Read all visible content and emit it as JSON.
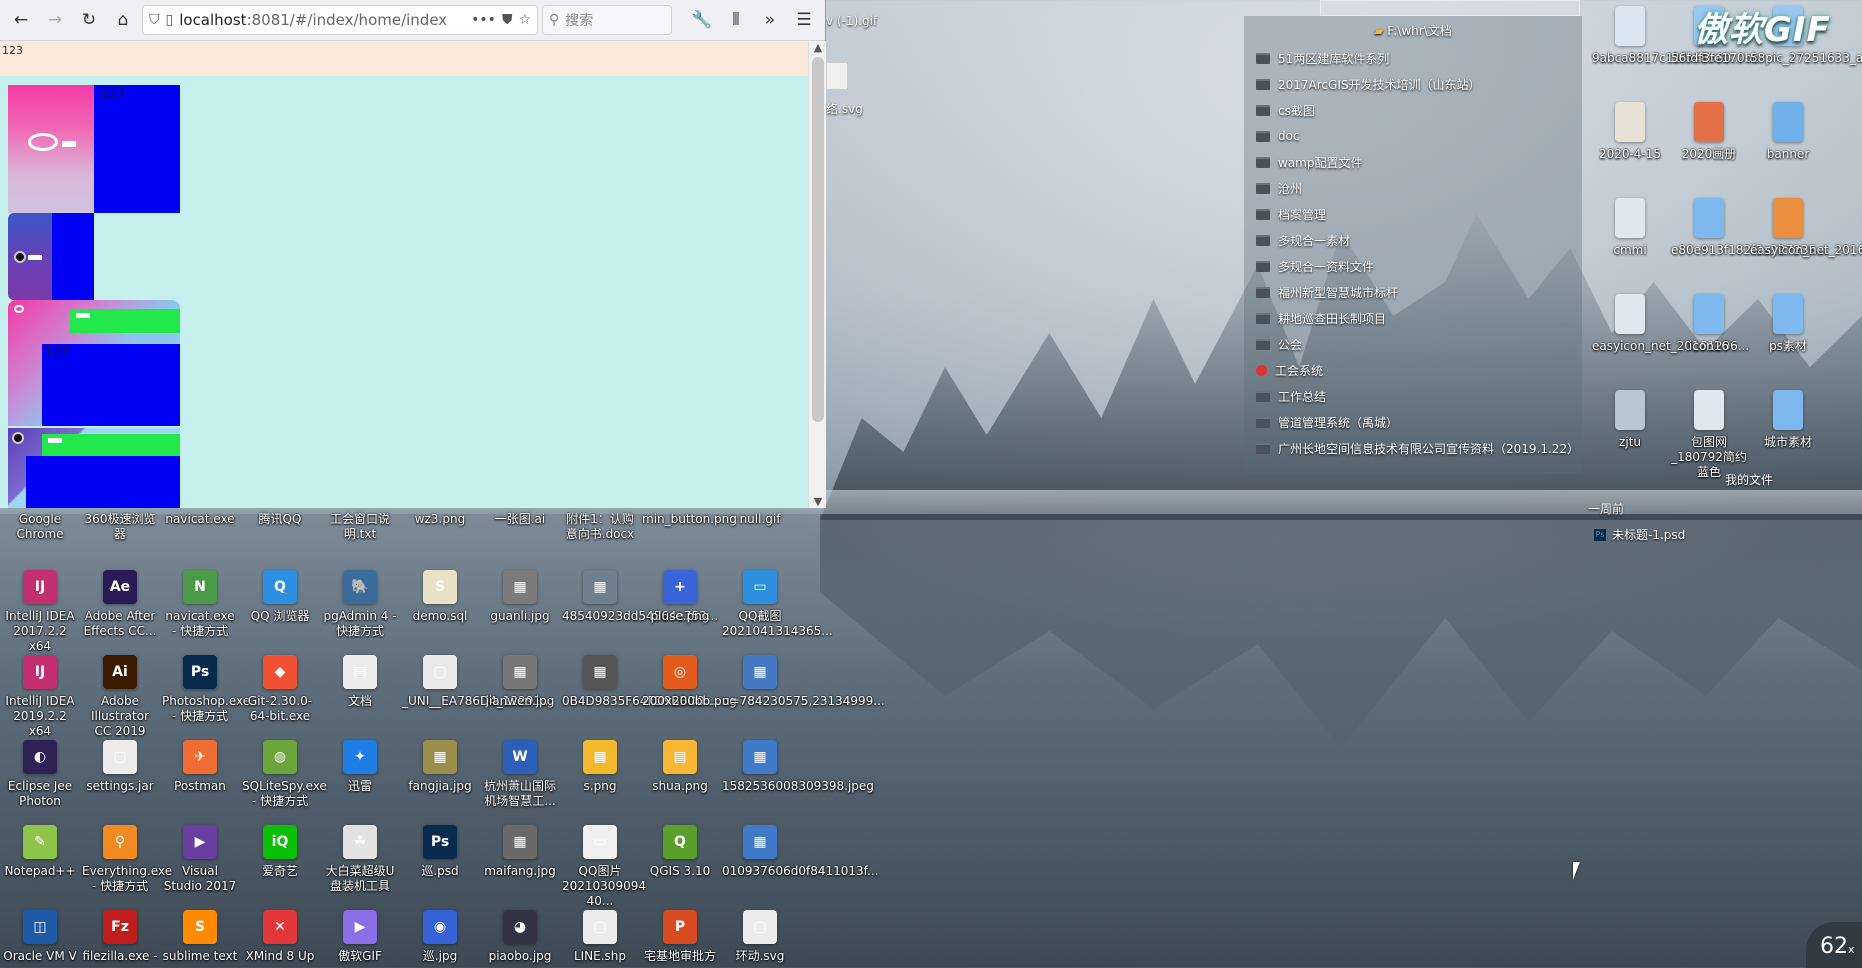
{
  "browser": {
    "url_host": "localhost",
    "url_rest": ":8081/#/index/home/index",
    "search_placeholder": "搜索",
    "page_header_text": "123",
    "blocks": [
      {
        "label": "123"
      },
      {
        "label": "123"
      }
    ]
  },
  "desktop_icons": [
    {
      "label": "Google Chrome",
      "glyph": "●",
      "color": "#e2473a"
    },
    {
      "label": "360极速浏览器",
      "glyph": "◉",
      "color": "#3a8fe2"
    },
    {
      "label": "navicat.exe",
      "glyph": "N",
      "color": "#4a9a4a"
    },
    {
      "label": "腾讯QQ",
      "glyph": "Q",
      "color": "#2b7fd5"
    },
    {
      "label": "工会窗口说明.txt",
      "glyph": "≡",
      "color": "#dcdcdc"
    },
    {
      "label": "wz3.png",
      "glyph": "▣",
      "color": "#3c7fbf"
    },
    {
      "label": "一张图.ai",
      "glyph": "Ai",
      "color": "#ff9a00"
    },
    {
      "label": "附件1：认购意向书.docx",
      "glyph": "W",
      "color": "#2b5fb8"
    },
    {
      "label": "min_button.png",
      "glyph": "▭",
      "color": "#cfd6dc"
    },
    {
      "label": "null.gif",
      "glyph": "▢",
      "color": "#d0d0d0"
    },
    {
      "label": "IntelliJ IDEA 2017.2.2 x64",
      "glyph": "IJ",
      "color": "#c22f6e"
    },
    {
      "label": "Adobe After Effects CC...",
      "glyph": "Ae",
      "color": "#2a1a55"
    },
    {
      "label": "navicat.exe - 快捷方式",
      "glyph": "N",
      "color": "#4a9a4a"
    },
    {
      "label": "QQ 浏览器",
      "glyph": "Q",
      "color": "#2c8fe0"
    },
    {
      "label": "pgAdmin 4 - 快捷方式",
      "glyph": "🐘",
      "color": "#3a6c99"
    },
    {
      "label": "demo.sql",
      "glyph": "S",
      "color": "#e8e1c5"
    },
    {
      "label": "guanli.jpg",
      "glyph": "▦",
      "color": "#7a7a7a"
    },
    {
      "label": "48540923dd54564e753...",
      "glyph": "▦",
      "color": "#6e7f8e"
    },
    {
      "label": "pluse.png",
      "glyph": "+",
      "color": "#3a63d6"
    },
    {
      "label": "QQ截图2021041314365...",
      "glyph": "▭",
      "color": "#2f8fdf"
    },
    {
      "label": "IntelliJ IDEA 2019.2.2 x64",
      "glyph": "IJ",
      "color": "#c22f6e"
    },
    {
      "label": "Adobe Illustrator CC 2019",
      "glyph": "Ai",
      "color": "#3a1b00"
    },
    {
      "label": "Photoshop.exe - 快捷方式",
      "glyph": "Ps",
      "color": "#0b2a4f"
    },
    {
      "label": "Git-2.30.0-64-bit.exe",
      "glyph": "◆",
      "color": "#f05133"
    },
    {
      "label": "文档",
      "glyph": "▤",
      "color": "#ececec"
    },
    {
      "label": "_UNI__EA786D4_12291...",
      "glyph": "▢",
      "color": "#e9e9e9"
    },
    {
      "label": "jianwen.jpg",
      "glyph": "▦",
      "color": "#777"
    },
    {
      "label": "0B4D9835F64FD9BBD0...",
      "glyph": "▦",
      "color": "#555"
    },
    {
      "label": "200x200bb.png",
      "glyph": "◎",
      "color": "#e25b1d"
    },
    {
      "label": "u=784230575,23134999...",
      "glyph": "▦",
      "color": "#4579c3"
    },
    {
      "label": "Eclipse Jee Photon",
      "glyph": "◐",
      "color": "#2c2255"
    },
    {
      "label": "settings.jar",
      "glyph": "▢",
      "color": "#ececec"
    },
    {
      "label": "Postman",
      "glyph": "✈",
      "color": "#ef6c34"
    },
    {
      "label": "SQLiteSpy.exe - 快捷方式",
      "glyph": "◍",
      "color": "#6ba43b"
    },
    {
      "label": "迅雷",
      "glyph": "✦",
      "color": "#1f7de6"
    },
    {
      "label": "fangjia.jpg",
      "glyph": "▦",
      "color": "#9b8d4a"
    },
    {
      "label": "杭州萧山国际机场智慧工...",
      "glyph": "W",
      "color": "#2b5fb8"
    },
    {
      "label": "s.png",
      "glyph": "▦",
      "color": "#f1b82c"
    },
    {
      "label": "shua.png",
      "glyph": "▤",
      "color": "#f6b633"
    },
    {
      "label": "1582536008309398.jpeg",
      "glyph": "▦",
      "color": "#3f7bc8"
    },
    {
      "label": "Notepad++",
      "glyph": "✎",
      "color": "#8fc44a"
    },
    {
      "label": "Everything.exe - 快捷方式",
      "glyph": "⚲",
      "color": "#f28a23"
    },
    {
      "label": "Visual Studio 2017",
      "glyph": "▶",
      "color": "#6a3ea0"
    },
    {
      "label": "爱奇艺",
      "glyph": "iQ",
      "color": "#0bbe06"
    },
    {
      "label": "大白菜超级U盘装机工具",
      "glyph": "☘",
      "color": "#e2e2e2"
    },
    {
      "label": "巡.psd",
      "glyph": "Ps",
      "color": "#0b2a4f"
    },
    {
      "label": "maifang.jpg",
      "glyph": "▦",
      "color": "#6a6a6a"
    },
    {
      "label": "QQ图片20210309094​40...",
      "glyph": "▭",
      "color": "#f0f0f0"
    },
    {
      "label": "QGIS 3.10",
      "glyph": "Q",
      "color": "#5a9e2c"
    },
    {
      "label": "010937606d0f8411013f...",
      "glyph": "▦",
      "color": "#3f7bc8"
    },
    {
      "label": "Oracle VM V",
      "glyph": "◫",
      "color": "#1f5aa6"
    },
    {
      "label": "filezilla.exe -",
      "glyph": "Fz",
      "color": "#bf1c1c"
    },
    {
      "label": "sublime text",
      "glyph": "S",
      "color": "#ff8a00"
    },
    {
      "label": "XMind 8 Up",
      "glyph": "✕",
      "color": "#e3373a"
    },
    {
      "label": "傲软GIF",
      "glyph": "▶",
      "color": "#8c6de6"
    },
    {
      "label": "巡.jpg",
      "glyph": "◉",
      "color": "#3563d6"
    },
    {
      "label": "piaobo.jpg",
      "glyph": "◕",
      "color": "#334"
    },
    {
      "label": "LINE.shp",
      "glyph": "▢",
      "color": "#ececec"
    },
    {
      "label": "宅基地审批方",
      "glyph": "P",
      "color": "#d84b20"
    },
    {
      "label": "环动.svg",
      "glyph": "▢",
      "color": "#ececec"
    }
  ],
  "mid_labels": {
    "partial_gif": "v (-1).gif",
    "partial_svg": "络.svg"
  },
  "explorer": {
    "title": "F:\\whr\\文档",
    "folders": [
      {
        "name": "51两区建库软件系列",
        "red": false
      },
      {
        "name": "2017ArcGIS开发技术培训（山东站）",
        "red": false
      },
      {
        "name": "cs截图",
        "red": false
      },
      {
        "name": "doc",
        "red": false
      },
      {
        "name": "wamp配置文件",
        "red": false
      },
      {
        "name": "沧州",
        "red": false
      },
      {
        "name": "档案管理",
        "red": false
      },
      {
        "name": "多规合一素材",
        "red": false
      },
      {
        "name": "多规合一资料文件",
        "red": false
      },
      {
        "name": "福州新型智慧城市标杆",
        "red": false
      },
      {
        "name": "耕地巡查田长制项目",
        "red": false
      },
      {
        "name": "公会",
        "red": false
      },
      {
        "name": "工会系统",
        "red": true
      },
      {
        "name": "工作总结",
        "red": false
      },
      {
        "name": "管道管理系统（禹城）",
        "red": false
      },
      {
        "name": "广州长地空间信息技术有限公司宣传资料（2019.1.22）",
        "red": false
      }
    ],
    "footer": "我的文件",
    "recent_label": "一周前",
    "recent_file": "未标题-1.psd"
  },
  "right_icons": [
    {
      "label": "9abca8817c11fb48b60...",
      "glyph": "▮",
      "color": "#d9e6f2"
    },
    {
      "label": "56fdf3fe170be",
      "glyph": "▮",
      "color": "#9cc7ef"
    },
    {
      "label": "58pic_27251633_a4a5a...",
      "glyph": "▮",
      "color": "#9cc7ef"
    },
    {
      "label": "2020-4-15",
      "glyph": "▮",
      "color": "#e8e2d6"
    },
    {
      "label": "2020画册",
      "glyph": "▮",
      "color": "#e36f46"
    },
    {
      "label": "banner",
      "glyph": "▮",
      "color": "#6fb0ea"
    },
    {
      "label": "cmmi",
      "glyph": "▮",
      "color": "#dfe8f1"
    },
    {
      "label": "e80e913f182f3a227235...",
      "glyph": "▮",
      "color": "#7db9ee"
    },
    {
      "label": "easyicon_net_20161205...",
      "glyph": "▮",
      "color": "#e98f3e"
    },
    {
      "label": "easyicon_net_20161206...",
      "glyph": "▮",
      "color": "#dfe8f1"
    },
    {
      "label": "icon16",
      "glyph": "▮",
      "color": "#7db9ee"
    },
    {
      "label": "ps素材",
      "glyph": "▮",
      "color": "#7db9ee"
    },
    {
      "label": "zjtu",
      "glyph": "▮",
      "color": "#b7c6d3"
    },
    {
      "label": "包图网_180792简约蓝色",
      "glyph": "▮",
      "color": "#dfe8f1"
    },
    {
      "label": "城市素材",
      "glyph": "▮",
      "color": "#7db9ee"
    }
  ],
  "watermark": "傲软GIF",
  "speed_meter": "62",
  "speed_unit": "x"
}
